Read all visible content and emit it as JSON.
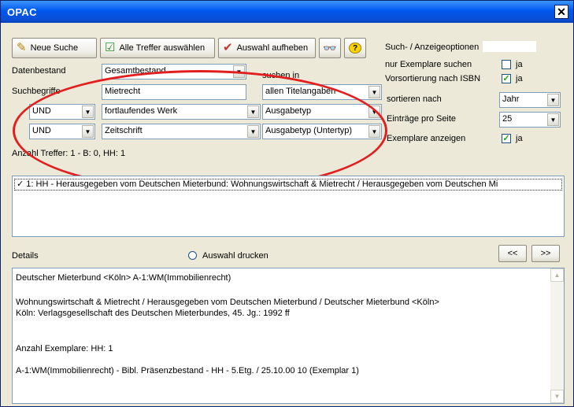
{
  "window": {
    "title": "OPAC",
    "close_symbol": "✕"
  },
  "toolbar": {
    "new_search": "Neue Suche",
    "select_all": "Alle Treffer auswählen",
    "clear_selection": "Auswahl aufheben"
  },
  "options": {
    "header": "Such- / Anzeigeoptionen",
    "copies_only_label": "nur Exemplare suchen",
    "copies_only_value": "ja",
    "copies_only_checked": false,
    "presort_label": "Vorsortierung nach ISBN",
    "presort_value": "ja",
    "presort_checked": true,
    "sort_label": "sortieren nach",
    "sort_value": "Jahr",
    "per_page_label": "Einträge pro Seite",
    "per_page_value": "25",
    "show_copies_label": "Exemplare anzeigen",
    "show_copies_value": "ja",
    "show_copies_checked": true
  },
  "search": {
    "datenbestand_label": "Datenbestand",
    "datenbestand_value": "Gesamtbestand",
    "suchen_in_label": "suchen in",
    "suchbegriffe_label": "Suchbegriffe",
    "row1_term": "Mietrecht",
    "row1_field": "allen Titelangaben",
    "row2_op": "UND",
    "row2_term": "fortlaufendes Werk",
    "row2_field": "Ausgabetyp",
    "row3_op": "UND",
    "row3_term": "Zeitschrift",
    "row3_field": "Ausgabetyp (Untertyp)",
    "hits": "Anzahl Treffer: 1 - B: 0, HH: 1"
  },
  "results": {
    "items": [
      "✓  1: HH - Herausgegeben vom Deutschen Mieterbund: Wohnungswirtschaft & Mietrecht / Herausgegeben vom Deutschen Mi"
    ]
  },
  "details": {
    "label": "Details",
    "print_label": "Auswahl drucken",
    "prev": "<<",
    "next": ">>",
    "lines": [
      "Deutscher Mieterbund <Köln> A-1:WM(Immobilienrecht)",
      "Wohnungswirtschaft & Mietrecht / Herausgegeben vom Deutschen Mieterbund / Deutscher Mieterbund <Köln>",
      "Köln: Verlagsgesellschaft des Deutschen Mieterbundes, 45. Jg.: 1992 ff",
      "Anzahl Exemplare:  HH: 1",
      "A-1:WM(Immobilienrecht) - Bibl. Präsenzbestand - HH - 5.Etg. / 25.10.00 10 (Exemplar 1)"
    ]
  },
  "colors": {
    "title_bar": "#0058ee",
    "annotation": "#e21f1f",
    "dialog_bg": "#ece9d8"
  }
}
